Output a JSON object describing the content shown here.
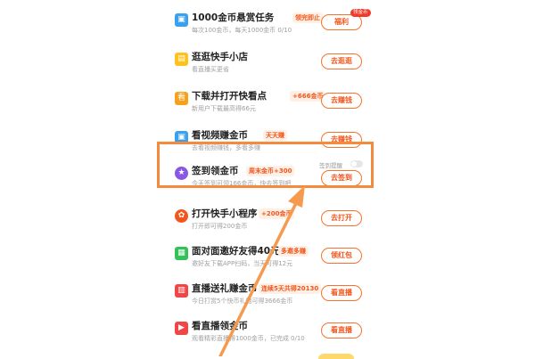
{
  "tasks": [
    {
      "title": "1000金币悬赏任务",
      "tag": "领完即止",
      "sub": "每次100金币，每天1000金币 0/10",
      "btn": "福利",
      "badge": "领金币"
    },
    {
      "title": "逛逛快手小店",
      "tag": "",
      "sub": "看直播买更省",
      "btn": "去逛逛"
    },
    {
      "title": "下载并打开快看点",
      "tag": "+666金币",
      "sub": "新用户下载最高得66元",
      "btn": "去赚钱"
    },
    {
      "title": "看视频赚金币",
      "tag": "天天赚",
      "sub": "去看视频赚钱，多看多赚",
      "btn": "去赚钱"
    },
    {
      "title": "签到领金币",
      "tag": "周末金币+300",
      "sub": "今天签到可领166金币，快去签到吧",
      "btn": "去签到",
      "remind": "签到提醒"
    },
    {
      "title": "打开快手小程序",
      "tag": "+200金币",
      "sub": "打开即可得200金币",
      "btn": "去打开"
    },
    {
      "title": "面对面邀好友得40元",
      "tag": "多邀多赚",
      "sub": "邀好友下载APP扫码，当天可得12元",
      "btn": "领红包"
    },
    {
      "title": "直播送礼赚金币",
      "tag": "连续5天共得20130",
      "sub": "今日打赏5个快币礼物可得3666金币",
      "btn": "看直播"
    },
    {
      "title": "看直播领金币",
      "tag": "",
      "sub": "观看精彩直播得1000金币，已完成 0/10",
      "btn": "看直播"
    }
  ],
  "colors": {
    "accent": "#f2561d",
    "highlight": "#f58a3c"
  }
}
